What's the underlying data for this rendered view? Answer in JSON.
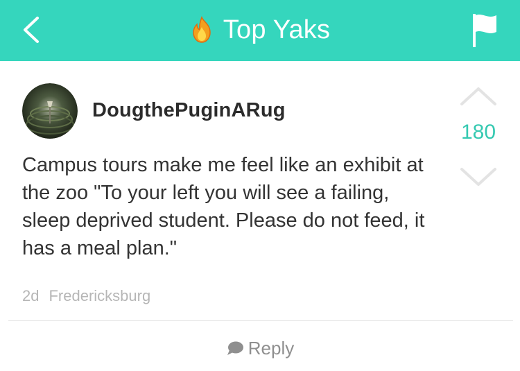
{
  "header": {
    "title": "Top Yaks",
    "background_color": "#35d6bd",
    "back_icon": "chevron-left-icon",
    "title_icon": "fire-icon",
    "action_icon": "flag-icon"
  },
  "post": {
    "username": "DougthePuginARug",
    "body": "Campus tours make me feel like an exhibit at the zoo \"To your left you will see a failing, sleep deprived student. Please do not feed, it has a meal plan.\"",
    "time": "2d",
    "location": "Fredericksburg",
    "score": "180",
    "accent_color": "#35c9b1"
  },
  "reply": {
    "label": "Reply",
    "icon": "speech-bubble-icon"
  }
}
